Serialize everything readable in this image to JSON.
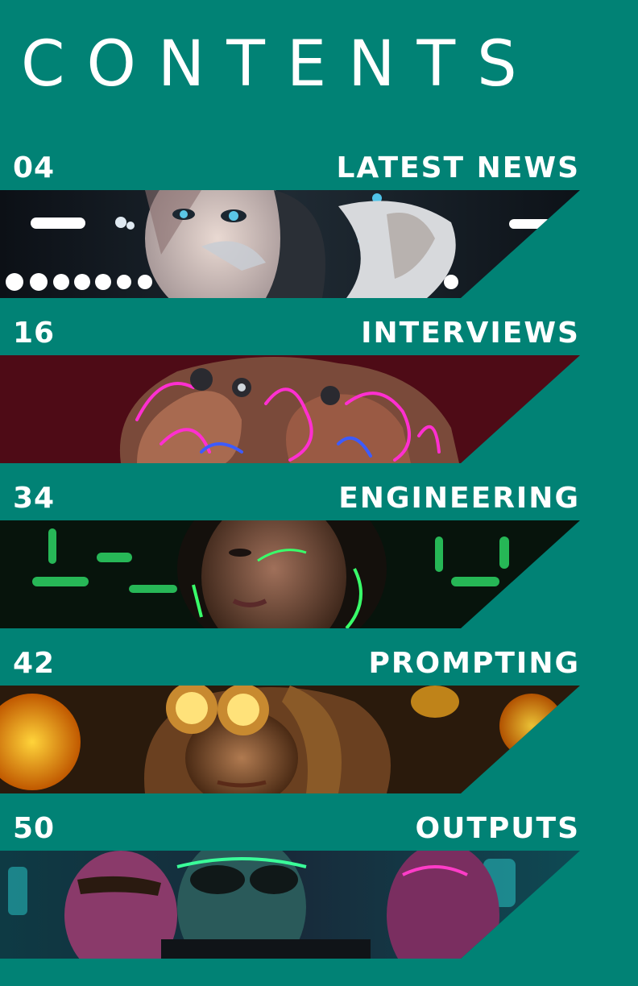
{
  "title": "CONTENTS",
  "sections": [
    {
      "page": "04",
      "label": "LATEST NEWS",
      "image": "cyborg-woman-portrait",
      "accent": "#4fc3e8"
    },
    {
      "page": "16",
      "label": "INTERVIEWS",
      "image": "neon-robot-figure",
      "accent": "#ff2fd0"
    },
    {
      "page": "34",
      "label": "ENGINEERING",
      "image": "green-neon-woman-portrait",
      "accent": "#39ff6a"
    },
    {
      "page": "42",
      "label": "PROMPTING",
      "image": "golden-goggles-woman-portrait",
      "accent": "#ffb020"
    },
    {
      "page": "50",
      "label": "OUTPUTS",
      "image": "neon-sunglasses-men-group",
      "accent": "#ff3cc8"
    }
  ]
}
